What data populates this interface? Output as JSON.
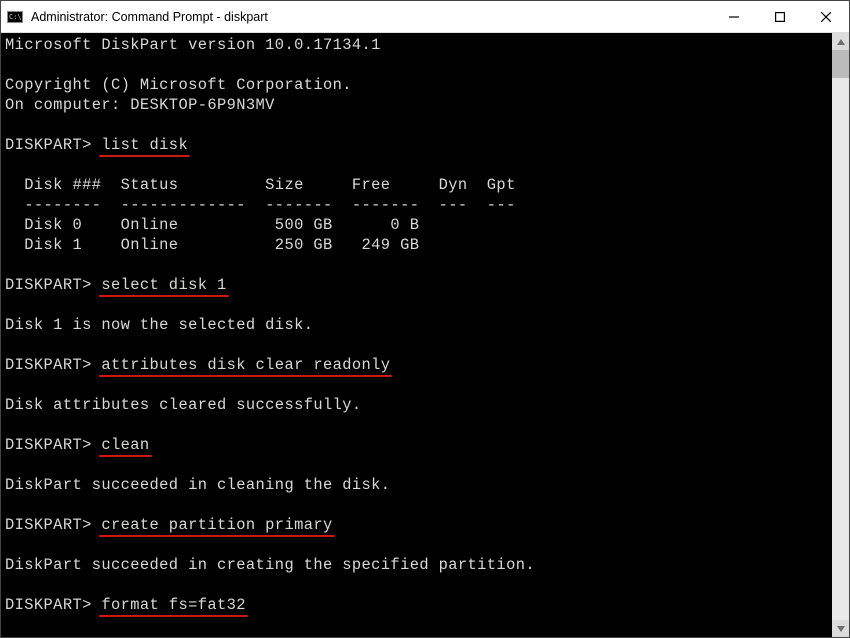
{
  "window": {
    "title": "Administrator: Command Prompt - diskpart"
  },
  "term": {
    "header1": "Microsoft DiskPart version 10.0.17134.1",
    "copyright": "Copyright (C) Microsoft Corporation.",
    "computer": "On computer: DESKTOP-6P9N3MV",
    "prompt": "DISKPART> ",
    "cmd_list_disk": "list disk",
    "tbl_hdr": "  Disk ###  Status         Size     Free     Dyn  Gpt",
    "tbl_sep": "  --------  -------------  -------  -------  ---  ---",
    "tbl_row0": "  Disk 0    Online          500 GB      0 B",
    "tbl_row1": "  Disk 1    Online          250 GB   249 GB",
    "cmd_select": "select disk 1",
    "msg_select": "Disk 1 is now the selected disk.",
    "cmd_attr": "attributes disk clear readonly",
    "msg_attr": "Disk attributes cleared successfully.",
    "cmd_clean": "clean",
    "msg_clean": "DiskPart succeeded in cleaning the disk.",
    "cmd_create": "create partition primary",
    "msg_create": "DiskPart succeeded in creating the specified partition.",
    "cmd_format": "format fs=fat32"
  }
}
